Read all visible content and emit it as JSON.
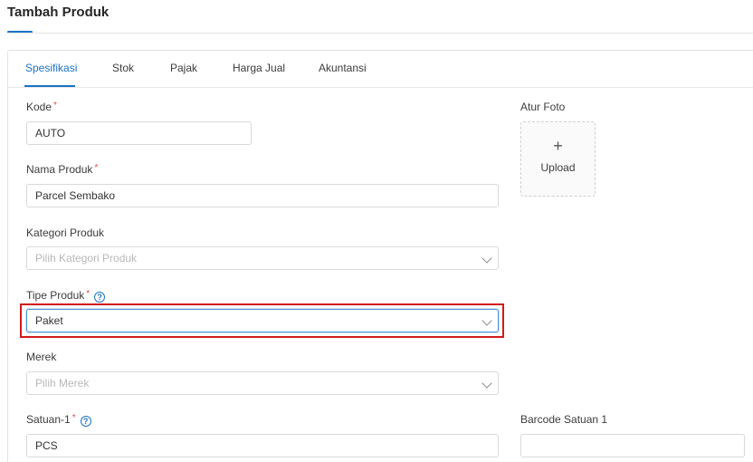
{
  "page": {
    "title": "Tambah Produk"
  },
  "tabs": [
    {
      "label": "Spesifikasi",
      "active": true
    },
    {
      "label": "Stok",
      "active": false
    },
    {
      "label": "Pajak",
      "active": false
    },
    {
      "label": "Harga Jual",
      "active": false
    },
    {
      "label": "Akuntansi",
      "active": false
    }
  ],
  "form": {
    "kode": {
      "label": "Kode",
      "required_mark": "*",
      "value": "AUTO"
    },
    "nama_produk": {
      "label": "Nama Produk",
      "required_mark": "*",
      "value": "Parcel Sembako"
    },
    "kategori_produk": {
      "label": "Kategori Produk",
      "placeholder": "Pilih Kategori Produk"
    },
    "tipe_produk": {
      "label": "Tipe Produk",
      "required_mark": "*",
      "help": "?",
      "value": "Paket"
    },
    "merek": {
      "label": "Merek",
      "placeholder": "Pilih Merek"
    },
    "satuan_1": {
      "label": "Satuan-1",
      "required_mark": "*",
      "help": "?",
      "value": "PCS"
    },
    "barcode_satuan_1": {
      "label": "Barcode Satuan 1",
      "value": ""
    }
  },
  "photo": {
    "label": "Atur Foto",
    "plus": "+",
    "upload_label": "Upload"
  },
  "colors": {
    "accent": "#1a73c7",
    "required": "#e04b4b",
    "highlight": "#d11a1a"
  }
}
